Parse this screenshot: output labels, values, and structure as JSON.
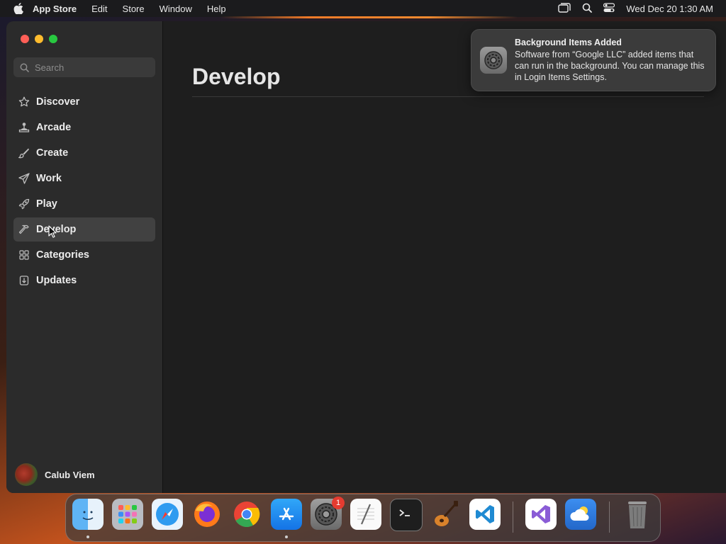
{
  "menubar": {
    "app_name": "App Store",
    "menus": [
      "Edit",
      "Store",
      "Window",
      "Help"
    ],
    "datetime": "Wed Dec 20  1:30 AM"
  },
  "sidebar": {
    "search_placeholder": "Search",
    "items": [
      {
        "label": "Discover",
        "icon": "star-icon"
      },
      {
        "label": "Arcade",
        "icon": "joystick-icon"
      },
      {
        "label": "Create",
        "icon": "brush-icon"
      },
      {
        "label": "Work",
        "icon": "paper-plane-icon"
      },
      {
        "label": "Play",
        "icon": "rocket-icon"
      },
      {
        "label": "Develop",
        "icon": "hammer-icon",
        "selected": true
      },
      {
        "label": "Categories",
        "icon": "grid-icon"
      },
      {
        "label": "Updates",
        "icon": "download-icon"
      }
    ],
    "user_name": "Calub Viem"
  },
  "main": {
    "title": "Develop"
  },
  "notification": {
    "title": "Background Items Added",
    "body": "Software from “Google LLC” added items that can run in the background. You can manage this in Login Items Settings."
  },
  "dock": {
    "apps": [
      "Finder",
      "Launchpad",
      "Safari",
      "Firefox",
      "Chrome",
      "App Store",
      "System Settings",
      "TextEdit",
      "Terminal",
      "GarageBand",
      "Visual Studio Code",
      "Visual Studio",
      "Weather",
      "Trash"
    ],
    "settings_badge": "1"
  },
  "colors": {
    "close": "#ff5f57",
    "minimize": "#febc2e",
    "zoom": "#28c840",
    "accent_orange": "#f07a28"
  }
}
